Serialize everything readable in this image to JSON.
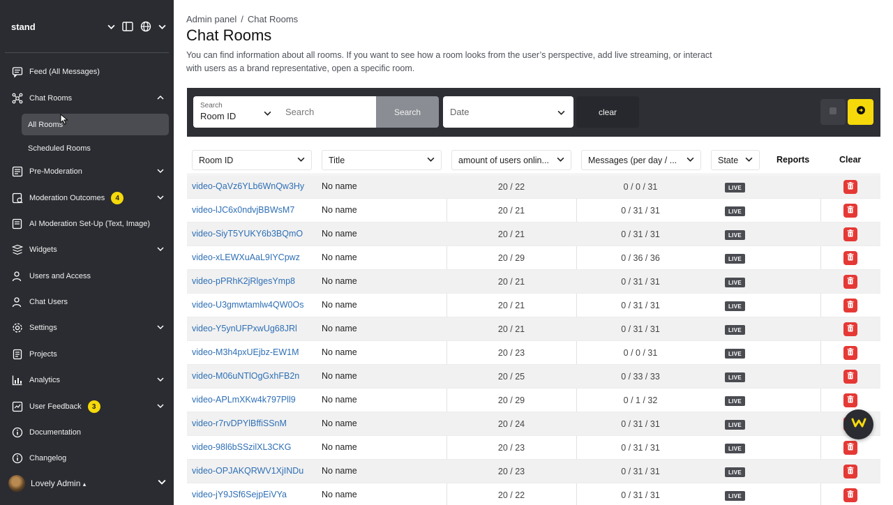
{
  "workspace": {
    "name": "stand"
  },
  "nav": {
    "items": [
      {
        "label": "Feed (All Messages)",
        "icon": "feed-icon"
      },
      {
        "label": "Chat Rooms",
        "icon": "chat-rooms-icon",
        "expanded": true
      },
      {
        "label": "Pre-Moderation",
        "icon": "pre-moderation-icon"
      },
      {
        "label": "Moderation Outcomes",
        "icon": "moderation-outcomes-icon",
        "badge": "4"
      },
      {
        "label": "AI Moderation Set-Up (Text, Image)",
        "icon": "ai-moderation-icon"
      },
      {
        "label": "Widgets",
        "icon": "widgets-icon"
      },
      {
        "label": "Users and Access",
        "icon": "users-access-icon"
      },
      {
        "label": "Chat Users",
        "icon": "chat-users-icon"
      },
      {
        "label": "Settings",
        "icon": "settings-icon"
      },
      {
        "label": "Projects",
        "icon": "projects-icon"
      },
      {
        "label": "Analytics",
        "icon": "analytics-icon"
      },
      {
        "label": "User Feedback",
        "icon": "user-feedback-icon",
        "badge": "3"
      },
      {
        "label": "Documentation",
        "icon": "documentation-icon"
      },
      {
        "label": "Changelog",
        "icon": "changelog-icon"
      }
    ],
    "sub_items": [
      {
        "label": "All Rooms",
        "active": true
      },
      {
        "label": "Scheduled Rooms",
        "active": false
      }
    ]
  },
  "user": {
    "name": "Lovely Admin",
    "caret": "▴"
  },
  "breadcrumb": {
    "root": "Admin panel",
    "separator": "/",
    "current": "Chat Rooms"
  },
  "page": {
    "title": "Chat Rooms",
    "description": "You can find information about all rooms. If you want to see how a room looks from the user’s perspective, add live streaming, or interact with users as a brand representative, open a specific room."
  },
  "filters": {
    "search_field_label": "Search",
    "search_field_value": "Room ID",
    "search_placeholder": "Search",
    "search_button": "Search",
    "date_placeholder": "Date",
    "clear_button": "clear"
  },
  "table": {
    "headers": {
      "room_id": "Room ID",
      "title": "Title",
      "users": "amount of users onlin...",
      "messages": "Messages (per day / ...",
      "state": "State",
      "reports": "Reports",
      "clear": "Clear"
    },
    "rows": [
      {
        "id": "video-QaVz6YLb6WnQw3Hy",
        "title": "No name",
        "users": "20 / 22",
        "messages": "0 / 0 / 31",
        "state": "LIVE"
      },
      {
        "id": "video-lJC6x0ndvjBBWsM7",
        "title": "No name",
        "users": "20 / 21",
        "messages": "0 / 31 / 31",
        "state": "LIVE"
      },
      {
        "id": "video-SiyT5YUKY6b3BQmO",
        "title": "No name",
        "users": "20 / 21",
        "messages": "0 / 31 / 31",
        "state": "LIVE"
      },
      {
        "id": "video-xLEWXuAaL9IYCpwz",
        "title": "No name",
        "users": "20 / 29",
        "messages": "0 / 36 / 36",
        "state": "LIVE"
      },
      {
        "id": "video-pPRhK2jRlgesYmp8",
        "title": "No name",
        "users": "20 / 21",
        "messages": "0 / 31 / 31",
        "state": "LIVE"
      },
      {
        "id": "video-U3gmwtamlw4QW0Os",
        "title": "No name",
        "users": "20 / 21",
        "messages": "0 / 31 / 31",
        "state": "LIVE"
      },
      {
        "id": "video-Y5ynUFPxwUg68JRl",
        "title": "No name",
        "users": "20 / 21",
        "messages": "0 / 31 / 31",
        "state": "LIVE"
      },
      {
        "id": "video-M3h4pxUEjbz-EW1M",
        "title": "No name",
        "users": "20 / 23",
        "messages": "0 / 0 / 31",
        "state": "LIVE"
      },
      {
        "id": "video-M06uNTlOgGxhFB2n",
        "title": "No name",
        "users": "20 / 25",
        "messages": "0 / 33 / 33",
        "state": "LIVE"
      },
      {
        "id": "video-APLmXKw4k797Pll9",
        "title": "No name",
        "users": "20 / 29",
        "messages": "0 / 1 / 32",
        "state": "LIVE"
      },
      {
        "id": "video-r7rvDPYlBffiSSnM",
        "title": "No name",
        "users": "20 / 24",
        "messages": "0 / 31 / 31",
        "state": "LIVE"
      },
      {
        "id": "video-98l6bSSzilXL3CKG",
        "title": "No name",
        "users": "20 / 23",
        "messages": "0 / 31 / 31",
        "state": "LIVE"
      },
      {
        "id": "video-OPJAKQRWV1XjINDu",
        "title": "No name",
        "users": "20 / 23",
        "messages": "0 / 31 / 31",
        "state": "LIVE"
      },
      {
        "id": "video-jY9JSf6SejpEiVYa",
        "title": "No name",
        "users": "20 / 22",
        "messages": "0 / 31 / 31",
        "state": "LIVE"
      }
    ]
  },
  "colors": {
    "sidebar": "#2a2c31",
    "accent_yellow": "#f5d90a",
    "link": "#2e6fb5",
    "delete": "#e53935"
  }
}
